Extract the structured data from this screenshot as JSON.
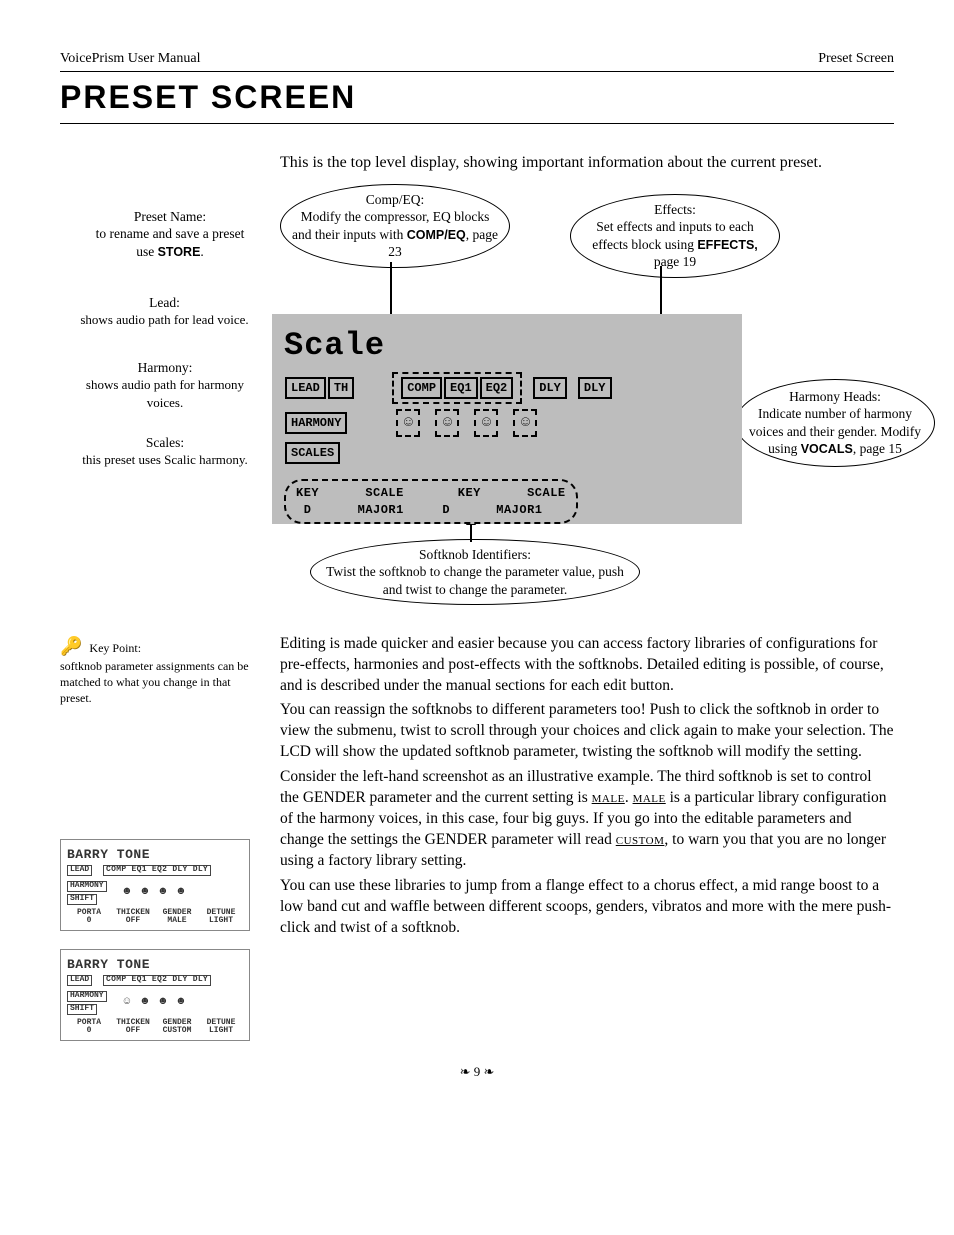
{
  "header": {
    "left": "VoicePrism User Manual",
    "right": "Preset Screen"
  },
  "title": "PRESET SCREEN",
  "intro": "This is the top level display, showing important information about the current preset.",
  "callouts": {
    "compeq_title": "Comp/EQ:",
    "compeq_body_a": "Modify the compressor, EQ blocks and their inputs with ",
    "compeq_bold": "COMP/EQ",
    "compeq_body_b": ", page 23",
    "effects_title": "Effects:",
    "effects_body_a": "Set effects and inputs to each effects block using ",
    "effects_bold": "EFFECTS,",
    "effects_body_b": " page 19",
    "preset_name_title": "Preset Name:",
    "preset_name_body_a": "to rename and save a preset use ",
    "preset_name_bold": "STORE",
    "preset_name_body_b": ".",
    "lead_title": "Lead:",
    "lead_body": "shows audio path for lead voice.",
    "harmony_title": "Harmony:",
    "harmony_body": "shows audio path for harmony voices.",
    "scales_title": "Scales:",
    "scales_body": "this preset uses Scalic harmony.",
    "heads_title": "Harmony Heads:",
    "heads_body_a": "Indicate number of harmony voices and their gender. Modify using ",
    "heads_bold": "VOCALS",
    "heads_body_b": ", page 15",
    "softknob_title": "Softknob Identifiers:",
    "softknob_body": "Twist the softknob to change the parameter value, push and twist to change the parameter."
  },
  "lcd_main": {
    "name": "Scale",
    "lead": "LEAD",
    "th": "TH",
    "comp": "COMP",
    "eq1": "EQ1",
    "eq2": "EQ2",
    "dly1": "DLY",
    "dly2": "DLY",
    "harmony": "HARMONY",
    "scales": "SCALES",
    "soft1_top": "KEY",
    "soft1_bot": "D",
    "soft2_top": "SCALE",
    "soft2_bot": "MAJOR1",
    "soft3_top": "KEY",
    "soft3_bot": "D",
    "soft4_top": "SCALE",
    "soft4_bot": "MAJOR1"
  },
  "keypoint": {
    "label": "Key Point:",
    "text": "softknob parameter assignments can be matched to what you change in that preset."
  },
  "body": {
    "p1_a": "Editing is made quicker and easier because you can access factory libraries of configurations for pre-effects, harmonies and post-effects with the softknobs. Detailed editing is possible, of course, and is described under the manual sections for each edit button.",
    "p2": "You can reassign the softknobs to different parameters too! Push to click the softknob in order to view the submenu, twist to scroll through your choices and click again to make your selection. The LCD will show the updated softknob parameter, twisting the softknob will modify the setting.",
    "p3_a": "Consider the left-hand screenshot as an illustrative example. The third softknob is set to control the ",
    "p3_gender": "GENDER",
    "p3_b": " parameter and the current setting is ",
    "p3_male1": "MALE",
    "p3_c": ". ",
    "p3_male2": "MALE",
    "p3_d": " is a particular library configuration of the harmony voices, in this case, four big guys. If you go into the editable parameters and change the settings the ",
    "p3_gender2": "GENDER",
    "p3_e": " parameter will read ",
    "p3_custom": "CUSTOM",
    "p3_f": ", to warn you that you are no longer using a factory library setting.",
    "p4": "You can use these libraries to jump from a flange effect to a chorus effect, a mid range boost to a low band cut and waffle between different scoops, genders, vibratos and more with the mere push-click and twist of a softknob."
  },
  "lcd_small": [
    {
      "name": "BARRY TONE",
      "lead": "LEAD",
      "chain": "COMP EQ1 EQ2 DLY DLY",
      "harmony": "HARMONY",
      "shift": "SHIFT",
      "params": [
        {
          "k": "PORTA",
          "v": "0"
        },
        {
          "k": "THICKEN",
          "v": "OFF"
        },
        {
          "k": "GENDER",
          "v": "MALE"
        },
        {
          "k": "DETUNE",
          "v": "LIGHT"
        }
      ]
    },
    {
      "name": "BARRY TONE",
      "lead": "LEAD",
      "chain": "COMP EQ1 EQ2 DLY DLY",
      "harmony": "HARMONY",
      "shift": "SHIFT",
      "params": [
        {
          "k": "PORTA",
          "v": "0"
        },
        {
          "k": "THICKEN",
          "v": "OFF"
        },
        {
          "k": "GENDER",
          "v": "CUSTOM"
        },
        {
          "k": "DETUNE",
          "v": "LIGHT"
        }
      ]
    }
  ],
  "page_number": "❧ 9 ❧"
}
